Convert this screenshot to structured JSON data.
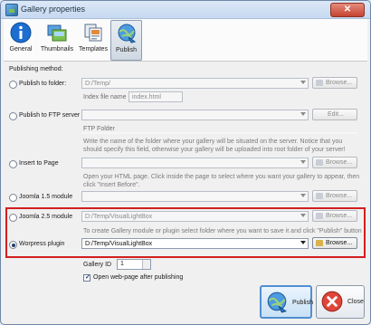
{
  "window": {
    "title": "Gallery properties",
    "close_glyph": "✕"
  },
  "toolbar": {
    "tabs": [
      {
        "label": "General",
        "icon": "info-icon"
      },
      {
        "label": "Thumbnails",
        "icon": "thumbnails-icon"
      },
      {
        "label": "Templates",
        "icon": "templates-icon"
      },
      {
        "label": "Publish",
        "icon": "publish-globe-icon",
        "active": true
      }
    ]
  },
  "publishing": {
    "section_label": "Publishing method:",
    "folder": {
      "label": "Publish to folder:",
      "value": "D:/Temp/",
      "browse": "Browse...",
      "index_label": "Index file name",
      "index_value": "index.html"
    },
    "ftp": {
      "label": "Publish to FTP server",
      "edit": "Edit...",
      "ftp_folder_label": "FTP Folder",
      "note": "Write the name of the folder where your gallery will be situated on the server. Notice that you should specify this field, otherwise your gallery will be uploaded into root folder of your server!"
    },
    "page": {
      "label": "Insert to Page",
      "browse": "Browse...",
      "note": "Open your HTML page. Click inside the page to select where you want your gallery to appear, then click \"Insert Before\"."
    },
    "joomla15": {
      "label": "Joomla 1.5 module",
      "browse": "Browse..."
    },
    "joomla25": {
      "label": "Joomla 2.5 module",
      "value": "D:/Temp/VisualLightBox",
      "browse": "Browse...",
      "note": "To create Gallery module or plugin select folder where you want to save it and click \"Publish\" button."
    },
    "wordpress": {
      "label": "Worpress plugin",
      "value": "D:/Temp/VisualLightBox",
      "browse": "Browse...",
      "selected": true
    }
  },
  "gallery_id": {
    "label": "Gallery ID",
    "value": "1"
  },
  "open_after": {
    "label": "Open web-page after publishing",
    "checked": true
  },
  "buttons": {
    "publish": "Publish",
    "close": "Close"
  },
  "colors": {
    "highlight_border": "#d21f1f",
    "primary_button_border": "#4f8fd1"
  }
}
